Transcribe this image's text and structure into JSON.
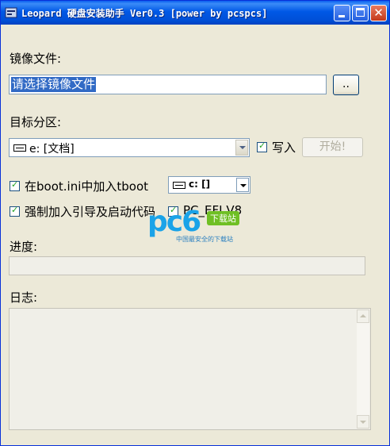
{
  "window": {
    "title": "Leopard 硬盘安装助手 Ver0.3 [power by pcspcs]"
  },
  "image_section": {
    "label": "镜像文件:",
    "path_value": "请选择镜像文件",
    "browse_label": ".."
  },
  "partition_section": {
    "label": "目标分区:",
    "selected": "e: [文档]",
    "write_checkbox_label": "写入",
    "write_checked": true,
    "start_label": "开始!"
  },
  "options": {
    "bootini_label": "在boot.ini中加入tboot",
    "bootini_checked": true,
    "boot_drive": "c: []",
    "force_label": "强制加入引导及启动代码",
    "force_checked": true,
    "pc_efi_label": "PC_EFI V8",
    "pc_efi_checked": true
  },
  "progress": {
    "label": "进度:",
    "value": 0
  },
  "log": {
    "label": "日志:",
    "content": ""
  },
  "watermark": {
    "logo": "pc6",
    "badge": "下载站",
    "sub": "中国最安全的下载站"
  },
  "colors": {
    "titlebar": "#0054e3",
    "face": "#ece9d8",
    "selection": "#316ac5",
    "check": "#21a121"
  }
}
